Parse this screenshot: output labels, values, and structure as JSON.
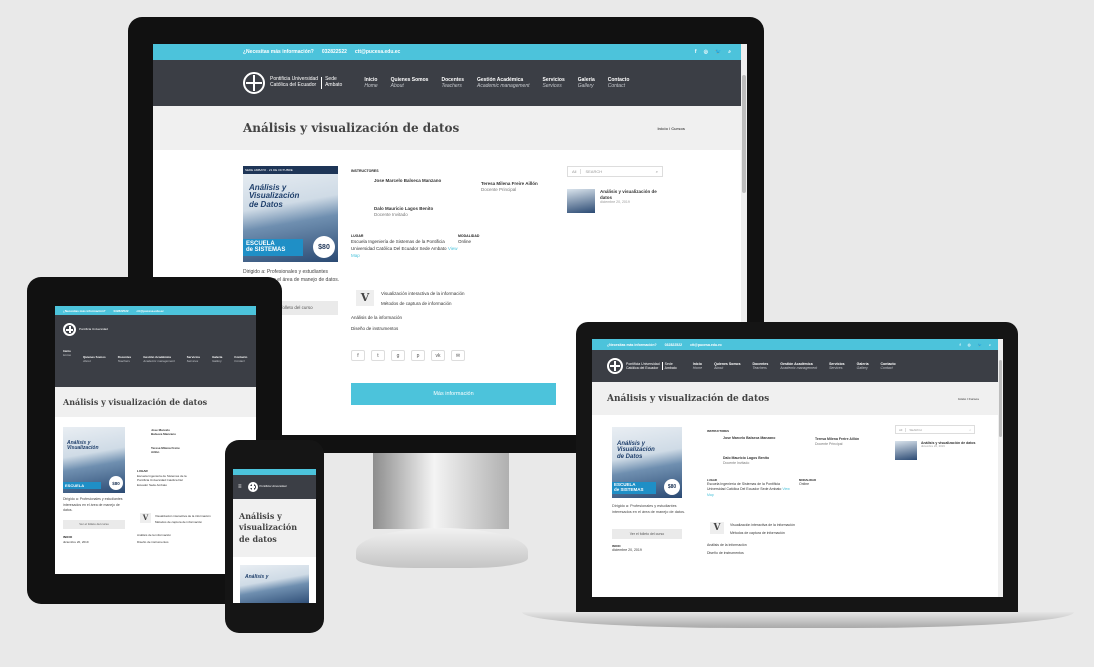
{
  "site": {
    "topbar": {
      "question": "¿Necesitas más información?",
      "phone": "032822522",
      "email": "ctt@pucesa.edu.ec",
      "icons": [
        "facebook-icon",
        "instagram-icon",
        "twitter-icon",
        "search-icon"
      ]
    },
    "logo": {
      "line1": "Pontificia Universidad",
      "line2": "Católica del Ecuador",
      "sub1": "Sede",
      "sub2": "Ambato"
    },
    "nav": [
      {
        "label": "Inicio",
        "sub": "Home"
      },
      {
        "label": "Quienes Somos",
        "sub": "About"
      },
      {
        "label": "Docentes",
        "sub": "Teachers"
      },
      {
        "label": "Gestión Académica",
        "sub": "Academic management"
      },
      {
        "label": "Servicios",
        "sub": "Services"
      },
      {
        "label": "Galería",
        "sub": "Gallery"
      },
      {
        "label": "Contacto",
        "sub": "Contact"
      }
    ],
    "page_title": "Análisis y visualización de datos",
    "breadcrumb": "Inicio / Cursos",
    "poster": {
      "top": "SEDE AMBATO · 21 DE OCTUBRE",
      "title_a": "Análisis y",
      "title_b": "Visualización",
      "title_c": "de Datos",
      "school": "ESCUELA",
      "school2": "de SISTEMAS",
      "price": "$80"
    },
    "intro": "Dirigido a: Profesionales y estudiantes interesados en el área de manejo de datos.",
    "details_button": "Ver el folleto del curso",
    "date_label": "Inicio",
    "date_value": "diciembre 20, 2019",
    "instructors_label": "Instructores",
    "instructors": [
      {
        "name": "Jose Marcelo Balseca Manzano",
        "role": "Docente Invitado"
      },
      {
        "name": "Teresa Milena Freire Aillón",
        "role": "Docente Principal"
      },
      {
        "name": "Dalo Mauricio Lagos Benito",
        "role": "Docente Invitado"
      }
    ],
    "org_label": "Lugar",
    "org_value": "Escuela Ingeniería de Sistemas de la Pontificia Universidad Católica Del Ecuador Sede Ambato",
    "org_link": "View Map",
    "modality_label": "Modalidad",
    "modality_value": "Online",
    "topics_letter": "V",
    "topics": [
      "Visualización interactiva de la información",
      "Métodos de captura de información",
      "Análisis de la información",
      "Diseño de instrumentos"
    ],
    "share_icons": [
      "facebook-icon",
      "twitter-icon",
      "google-plus-icon",
      "pinterest-icon",
      "vk-icon",
      "email-icon"
    ],
    "cta": "Más información",
    "search": {
      "category": "All",
      "placeholder": "SEARCH"
    },
    "recent": {
      "title": "Análisis y visualización de datos",
      "date": "diciembre 20, 2019"
    }
  }
}
